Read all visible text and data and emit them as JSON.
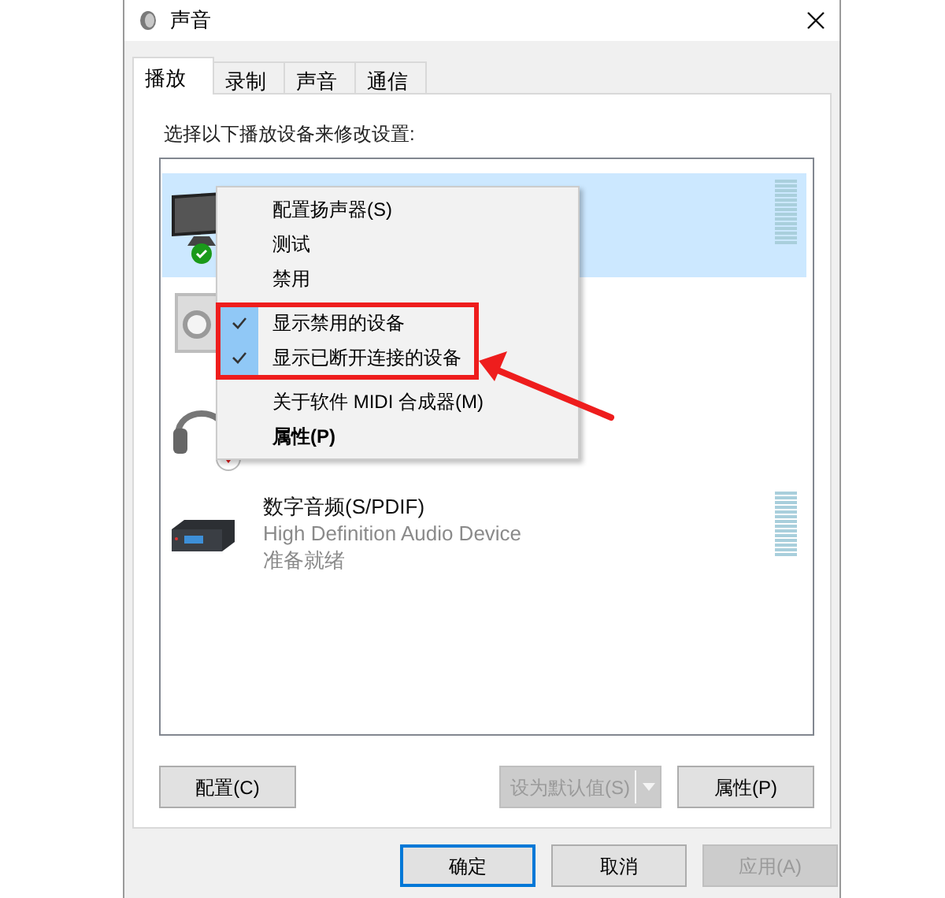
{
  "window": {
    "title": "声音"
  },
  "tabs": [
    {
      "label": "播放",
      "selected": true
    },
    {
      "label": "录制",
      "selected": false
    },
    {
      "label": "声音",
      "selected": false
    },
    {
      "label": "通信",
      "selected": false
    }
  ],
  "instruction": "选择以下播放设备来修改设置:",
  "devices": [
    {
      "kind": "monitor",
      "default": true,
      "unplugged": false,
      "selected": true,
      "meter": true
    },
    {
      "kind": "speaker",
      "default": false,
      "unplugged": false,
      "selected": false,
      "meter": false
    },
    {
      "kind": "headset",
      "default": false,
      "unplugged": true,
      "selected": false,
      "meter": false
    },
    {
      "kind": "receiver",
      "default": false,
      "unplugged": false,
      "selected": false,
      "meter": true,
      "name": "数字音频(S/PDIF)",
      "driver": "High Definition Audio Device",
      "state": "准备就绪"
    }
  ],
  "context_menu": {
    "items": [
      {
        "kind": "item",
        "label": "配置扬声器(S)",
        "checked": false,
        "bold": false
      },
      {
        "kind": "item",
        "label": "测试",
        "checked": false,
        "bold": false
      },
      {
        "kind": "item",
        "label": "禁用",
        "checked": false,
        "bold": false
      },
      {
        "kind": "separator"
      },
      {
        "kind": "item",
        "label": "显示禁用的设备",
        "checked": true,
        "bold": false
      },
      {
        "kind": "item",
        "label": "显示已断开连接的设备",
        "checked": true,
        "bold": false
      },
      {
        "kind": "separator"
      },
      {
        "kind": "item",
        "label": "关于软件 MIDI 合成器(M)",
        "checked": false,
        "bold": false
      },
      {
        "kind": "item",
        "label": "属性(P)",
        "checked": false,
        "bold": true
      }
    ]
  },
  "panel_buttons": [
    {
      "label": "配置(C)",
      "disabled": false,
      "kind": "plain"
    },
    {
      "label": "设为默认值(S)",
      "disabled": true,
      "kind": "split"
    },
    {
      "label": "属性(P)",
      "disabled": false,
      "kind": "plain"
    }
  ],
  "dialog_buttons": [
    {
      "label": "确定",
      "disabled": false,
      "default": true
    },
    {
      "label": "取消",
      "disabled": false,
      "default": false
    },
    {
      "label": "应用(A)",
      "disabled": true,
      "default": false
    }
  ]
}
